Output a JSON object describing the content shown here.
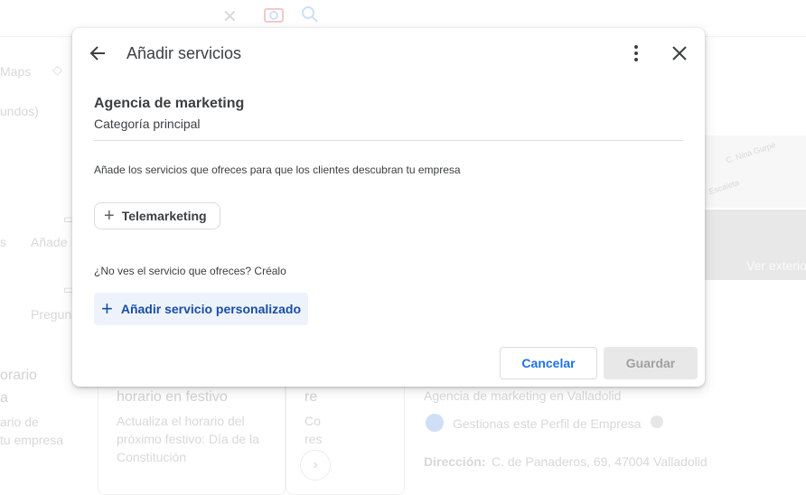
{
  "background": {
    "maps_label": "Maps",
    "fragment_undos": "undos)",
    "fragment_anade": "Añade",
    "fragment_pregu": "Pregun",
    "fragment_s": "s",
    "fragment_orario": "orario",
    "fragment_a": "a",
    "fragment_ario_de": "ario de",
    "fragment_tu_empresa": "tu empresa",
    "holiday_title": "horario en festivo",
    "holiday_text_1": "Actualiza el horario del",
    "holiday_text_2": "próximo festivo: Día de la",
    "holiday_text_3": "Constitución",
    "fragment_re": "re",
    "fragment_co": "Co",
    "fragment_res": "res",
    "business_category": "Agencia de marketing en Valladolid",
    "managed_text": "Gestionas este Perfil de Empresa",
    "address_label": "Dirección:",
    "address_value": "C. de Panaderos, 69, 47004 Valladolid",
    "map_text_1": "C. Nina Gurpé",
    "map_text_2": "Escaleta",
    "photo_label": "Ver exterio"
  },
  "dialog": {
    "title": "Añadir servicios",
    "category_name": "Agencia de marketing",
    "category_label": "Categoría principal",
    "description": "Añade los servicios que ofreces para que los clientes descubran tu empresa",
    "suggested_services": [
      {
        "label": "Telemarketing"
      }
    ],
    "hint": "¿No ves el servicio que ofreces? Créalo",
    "add_custom_label": "Añadir servicio personalizado",
    "cancel_label": "Cancelar",
    "save_label": "Guardar"
  },
  "colors": {
    "accent": "#1a73e8",
    "custom_button_bg": "#eef3fb",
    "disabled_bg": "#e8e8e8"
  }
}
